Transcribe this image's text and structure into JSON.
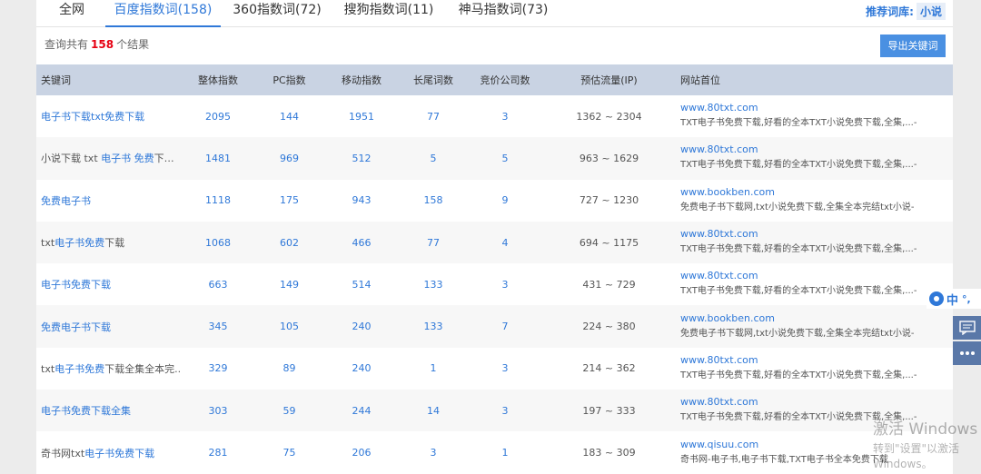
{
  "tabs": [
    {
      "label": "全网"
    },
    {
      "label": "百度指数词(158)"
    },
    {
      "label": "360指数词(72)"
    },
    {
      "label": "搜狗指数词(11)"
    },
    {
      "label": "神马指数词(73)"
    }
  ],
  "lib": {
    "label": "推荐词库:",
    "value": "小说"
  },
  "summary": {
    "prefix": "查询共有",
    "count": "158",
    "suffix": "个结果"
  },
  "export_label": "导出关键词",
  "columns": [
    "关键词",
    "整体指数",
    "PC指数",
    "移动指数",
    "长尾词数",
    "竞价公司数",
    "预估流量(IP)",
    "网站首位"
  ],
  "rows": [
    {
      "kw": [
        "",
        "电子书下载txt免费下载",
        ""
      ],
      "total": "2095",
      "pc": "144",
      "mobile": "1951",
      "longtail": "77",
      "bid": "3",
      "traffic": "1362 ~ 2304",
      "url": "www.80txt.com",
      "desc": "TXT电子书免费下载,好看的全本TXT小说免费下载,全集,...-"
    },
    {
      "kw": [
        "小说下载 txt ",
        "电子书 免费",
        "下载..."
      ],
      "total": "1481",
      "pc": "969",
      "mobile": "512",
      "longtail": "5",
      "bid": "5",
      "traffic": "963 ~ 1629",
      "url": "www.80txt.com",
      "desc": "TXT电子书免费下载,好看的全本TXT小说免费下载,全集,...-"
    },
    {
      "kw": [
        "",
        "免费电子书",
        ""
      ],
      "total": "1118",
      "pc": "175",
      "mobile": "943",
      "longtail": "158",
      "bid": "9",
      "traffic": "727 ~ 1230",
      "url": "www.bookben.com",
      "desc": "免费电子书下载网,txt小说免费下载,全集全本完结txt小说-"
    },
    {
      "kw": [
        "txt",
        "电子书免费",
        "下载"
      ],
      "total": "1068",
      "pc": "602",
      "mobile": "466",
      "longtail": "77",
      "bid": "4",
      "traffic": "694 ~ 1175",
      "url": "www.80txt.com",
      "desc": "TXT电子书免费下载,好看的全本TXT小说免费下载,全集,...-"
    },
    {
      "kw": [
        "",
        "电子书免费下载",
        ""
      ],
      "total": "663",
      "pc": "149",
      "mobile": "514",
      "longtail": "133",
      "bid": "3",
      "traffic": "431 ~ 729",
      "url": "www.80txt.com",
      "desc": "TXT电子书免费下载,好看的全本TXT小说免费下载,全集,...-"
    },
    {
      "kw": [
        "",
        "免费电子书下载",
        ""
      ],
      "total": "345",
      "pc": "105",
      "mobile": "240",
      "longtail": "133",
      "bid": "7",
      "traffic": "224 ~ 380",
      "url": "www.bookben.com",
      "desc": "免费电子书下载网,txt小说免费下载,全集全本完结txt小说-"
    },
    {
      "kw": [
        "txt",
        "电子书免费",
        "下载全集全本完.."
      ],
      "total": "329",
      "pc": "89",
      "mobile": "240",
      "longtail": "1",
      "bid": "3",
      "traffic": "214 ~ 362",
      "url": "www.80txt.com",
      "desc": "TXT电子书免费下载,好看的全本TXT小说免费下载,全集,...-"
    },
    {
      "kw": [
        "",
        "电子书免费下载全集",
        ""
      ],
      "total": "303",
      "pc": "59",
      "mobile": "244",
      "longtail": "14",
      "bid": "3",
      "traffic": "197 ~ 333",
      "url": "www.80txt.com",
      "desc": "TXT电子书免费下载,好看的全本TXT小说免费下载,全集,...-"
    },
    {
      "kw": [
        "奇书网txt",
        "电子书免费下载",
        ""
      ],
      "total": "281",
      "pc": "75",
      "mobile": "206",
      "longtail": "3",
      "bid": "1",
      "traffic": "183 ~ 309",
      "url": "www.qisuu.com",
      "desc": "奇书网-电子书,电子书下载,TXT电子书全本免费下载"
    }
  ],
  "ime": {
    "label": "中",
    "dots": "°,"
  },
  "watermark": {
    "line1": "激活 Windows",
    "line2": "转到\"设置\"以激活 Windows。"
  }
}
